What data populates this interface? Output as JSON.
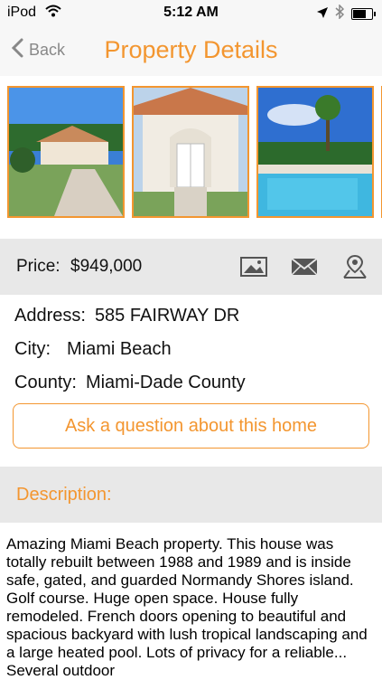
{
  "status": {
    "carrier": "iPod",
    "time": "5:12 AM"
  },
  "nav": {
    "back_label": "Back",
    "title": "Property Details"
  },
  "gallery": {
    "photos": [
      "house-front-photo",
      "front-door-photo",
      "pool-photo"
    ]
  },
  "price": {
    "label": "Price:",
    "value": "$949,000"
  },
  "details": {
    "address_label": "Address:",
    "address_value": "585 FAIRWAY DR",
    "city_label": "City:",
    "city_value": "Miami Beach",
    "county_label": "County:",
    "county_value": "Miami-Dade County"
  },
  "ask_button": "Ask a question about this home",
  "description": {
    "heading": "Description:",
    "text": "Amazing Miami Beach  property. This house was totally rebuilt between 1988 and 1989 and is inside safe, gated, and guarded Normandy Shores island. Golf course. Huge open space. House fully remodeled. French doors opening to beautiful and spacious backyard with lush tropical landscaping and a large heated pool. Lots of privacy for a reliable... Several outdoor"
  },
  "colors": {
    "accent": "#f39630",
    "bar_bg": "#e8e8e8"
  },
  "icons": [
    "wifi-icon",
    "location-arrow-icon",
    "bluetooth-icon",
    "battery-icon",
    "back-chevron-icon",
    "photo-icon",
    "mail-icon",
    "map-pin-icon"
  ]
}
